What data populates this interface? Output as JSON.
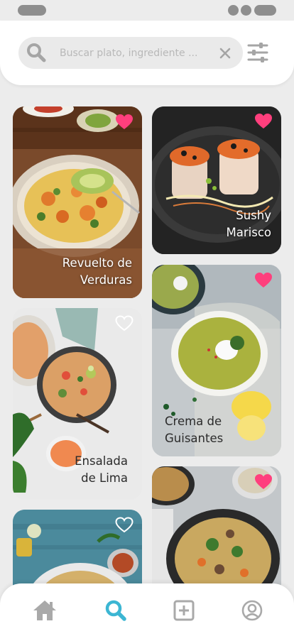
{
  "colors": {
    "accent": "#3cb6d3",
    "heart": "#ff3f7d",
    "icon_gray": "#8e8e8e",
    "icon_light": "#a5a5a5",
    "search_bg": "#eaeaea",
    "background": "#ececec"
  },
  "search": {
    "placeholder": "Buscar plato, ingrediente ...",
    "value": "",
    "icons": {
      "search": "search-icon",
      "clear": "close-icon",
      "filter": "sliders-icon"
    }
  },
  "recipes": [
    {
      "title_line1": "Revuelto de",
      "title_line2": "Verduras",
      "favorite": true
    },
    {
      "title_line1": "Sushy",
      "title_line2": "Marisco",
      "favorite": true
    },
    {
      "title_line1": "Ensalada",
      "title_line2": "de Lima",
      "favorite": false
    },
    {
      "title_line1": "Crema de",
      "title_line2": "Guisantes",
      "favorite": true
    },
    {
      "title_line1": "",
      "title_line2": "",
      "favorite": false
    },
    {
      "title_line1": "",
      "title_line2": "",
      "favorite": true
    }
  ],
  "nav": {
    "active": "search",
    "items": [
      "home-icon",
      "search-icon",
      "add-square-icon",
      "user-icon"
    ]
  }
}
